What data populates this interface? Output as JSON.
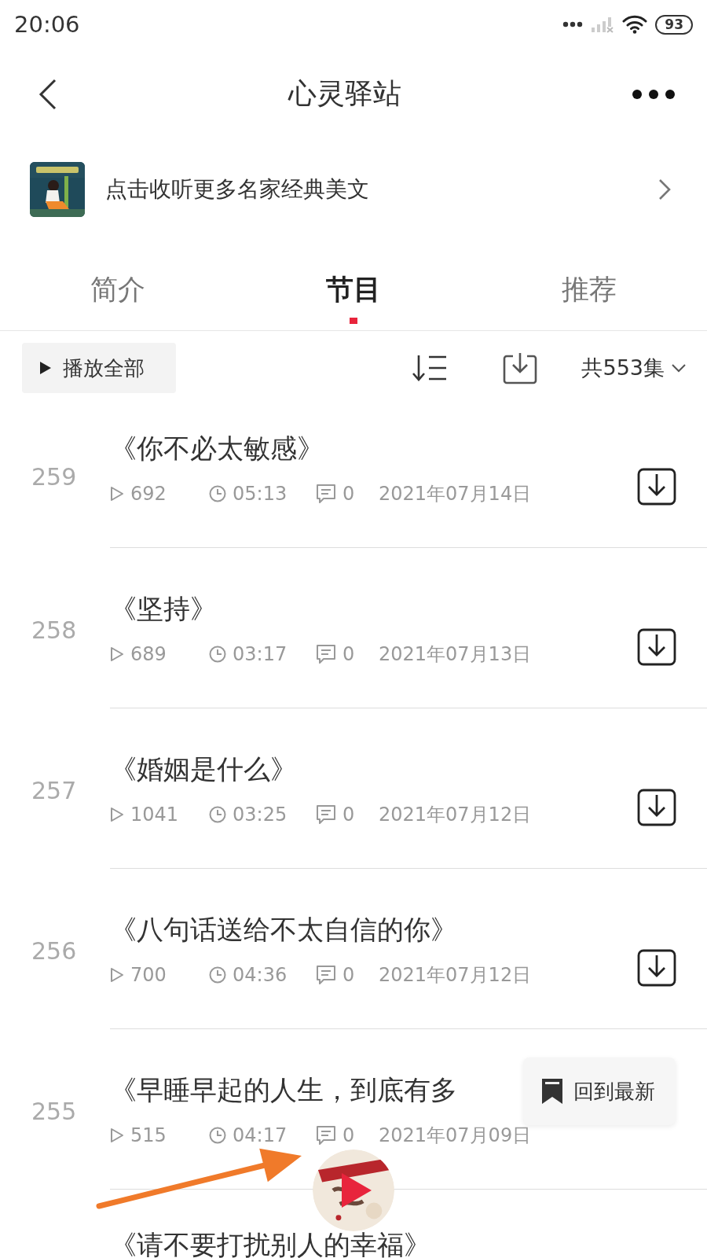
{
  "status_bar": {
    "time": "20:06",
    "battery": "93"
  },
  "header": {
    "title": "心灵驿站"
  },
  "banner": {
    "text": "点击收听更多名家经典美文"
  },
  "tabs": [
    {
      "label": "简介",
      "selected": false
    },
    {
      "label": "节目",
      "selected": true
    },
    {
      "label": "推荐",
      "selected": false
    }
  ],
  "toolbar": {
    "play_all": "播放全部",
    "count": "共553集"
  },
  "episodes": [
    {
      "number": "259",
      "title": "《你不必太敏感》",
      "plays": "692",
      "duration": "05:13",
      "comments": "0",
      "date": "2021年07月14日"
    },
    {
      "number": "258",
      "title": "《坚持》",
      "plays": "689",
      "duration": "03:17",
      "comments": "0",
      "date": "2021年07月13日"
    },
    {
      "number": "257",
      "title": "《婚姻是什么》",
      "plays": "1041",
      "duration": "03:25",
      "comments": "0",
      "date": "2021年07月12日"
    },
    {
      "number": "256",
      "title": "《八句话送给不太自信的你》",
      "plays": "700",
      "duration": "04:36",
      "comments": "0",
      "date": "2021年07月12日"
    },
    {
      "number": "255",
      "title": "《早睡早起的人生，到底有多",
      "plays": "515",
      "download": false,
      "duration": "04:17",
      "comments": "0",
      "date": "2021年07月09日"
    },
    {
      "title": "《请不要打扰别人的幸福》"
    }
  ],
  "back_to_latest": "回到最新"
}
